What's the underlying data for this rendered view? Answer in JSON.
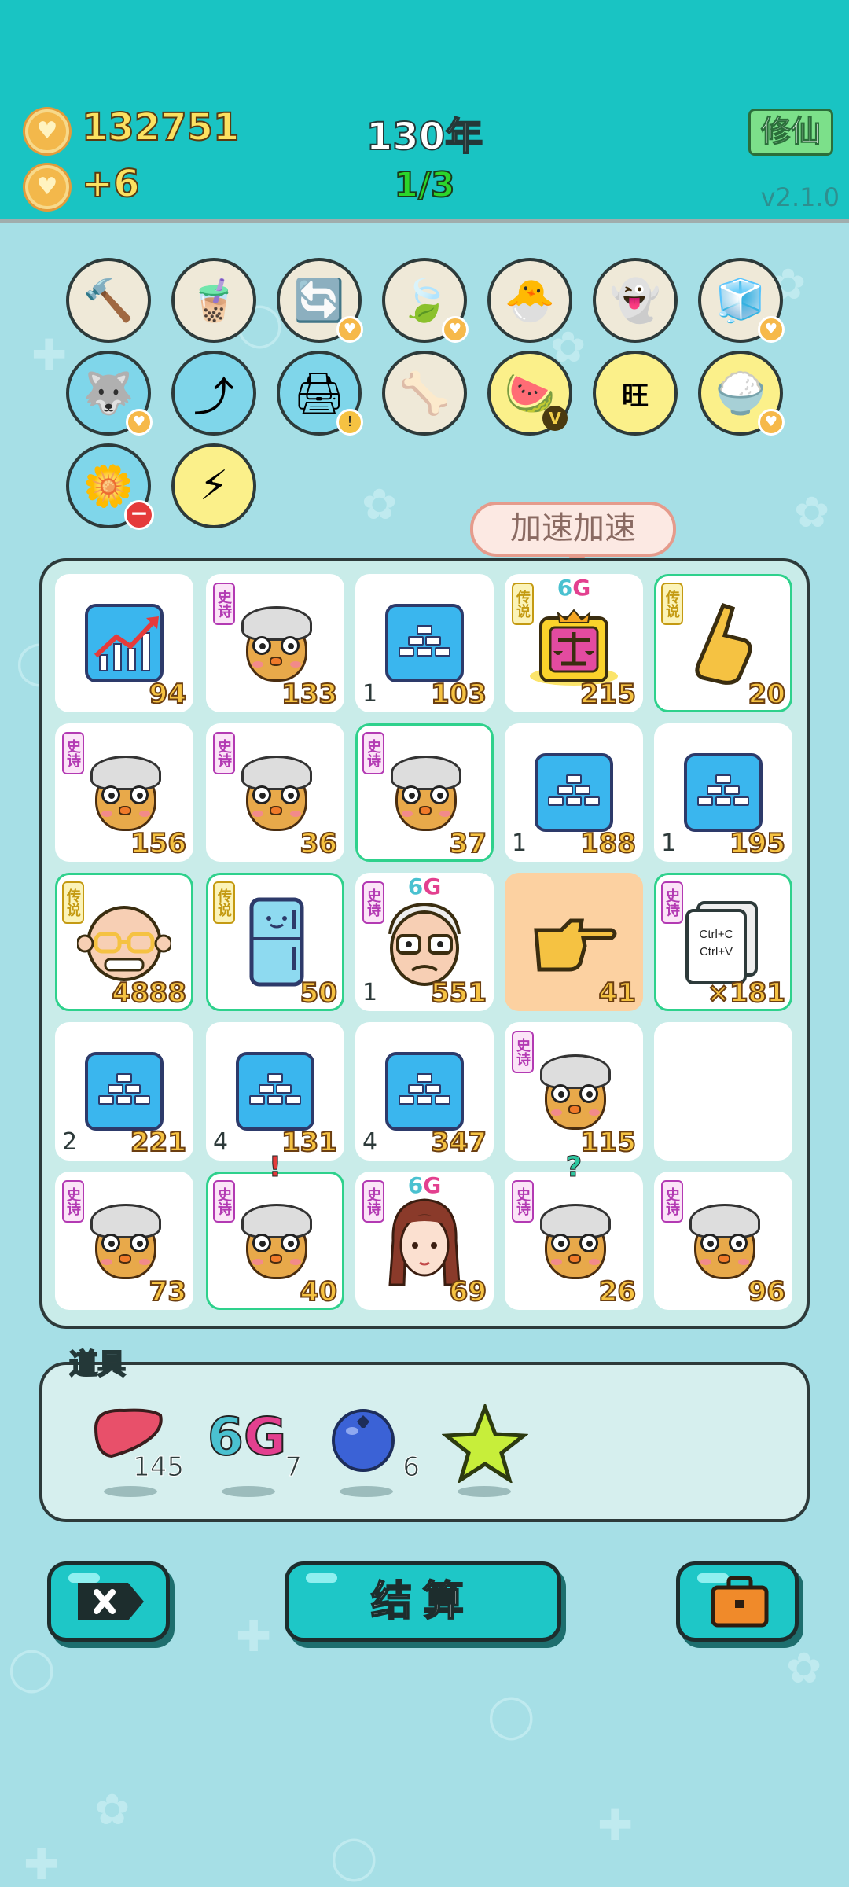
{
  "header": {
    "coins": "132751",
    "income": "+6",
    "year": "130年",
    "round": "1/3",
    "cultivate_button": "修仙",
    "version": "v2.1.0"
  },
  "skills": [
    {
      "icon": "hammer-icon",
      "glyph": "🔨"
    },
    {
      "icon": "milk-tea-icon",
      "glyph": "🧋"
    },
    {
      "icon": "refresh-icon",
      "glyph": "🔄",
      "heart": true
    },
    {
      "icon": "leaf-icon",
      "glyph": "🍃",
      "heart": true
    },
    {
      "icon": "chick-egg-icon",
      "glyph": "🐣"
    },
    {
      "icon": "ghost-icon",
      "glyph": "👻"
    },
    {
      "icon": "cubes-icon",
      "glyph": "🧊",
      "heart": true
    },
    {
      "icon": "husky-icon",
      "glyph": "🐺",
      "heart": true
    },
    {
      "icon": "arrow-card-icon",
      "glyph": "⤴"
    },
    {
      "icon": "printer-icon",
      "glyph": "🖨",
      "warn": true
    },
    {
      "icon": "dog-bowl-icon",
      "glyph": "🦴"
    },
    {
      "icon": "fruit-plate-icon",
      "glyph": "🍉",
      "v": "V"
    },
    {
      "icon": "wang-text-icon",
      "glyph": "旺"
    },
    {
      "icon": "rice-bowl-icon",
      "glyph": "🍚",
      "heart": true
    },
    {
      "icon": "flower-pot-icon",
      "glyph": "🌼",
      "minus": true
    },
    {
      "icon": "lightning-icon",
      "glyph": "⚡"
    }
  ],
  "tooltip": "加速加速",
  "badges": {
    "epic": "史诗",
    "legend": "传说"
  },
  "tag6g": {
    "six": "6",
    "g": "G"
  },
  "cells": [
    {
      "art": "chart",
      "num": "94"
    },
    {
      "art": "chick",
      "badge": "epic",
      "num": "133"
    },
    {
      "art": "gold",
      "lnum": "1",
      "num": "103"
    },
    {
      "art": "scale",
      "badge": "legend",
      "tag": "6G",
      "num": "215"
    },
    {
      "art": "pointer-up",
      "badge": "legend",
      "num": "20",
      "green": true
    },
    {
      "art": "chick",
      "badge": "epic",
      "num": "156"
    },
    {
      "art": "chick",
      "badge": "epic",
      "num": "36"
    },
    {
      "art": "chick",
      "badge": "epic",
      "num": "37",
      "green": true
    },
    {
      "art": "gold",
      "lnum": "1",
      "num": "188"
    },
    {
      "art": "gold",
      "lnum": "1",
      "num": "195"
    },
    {
      "art": "oldman",
      "badge": "legend",
      "num": "4888",
      "green": true
    },
    {
      "art": "fridge",
      "badge": "legend",
      "num": "50",
      "green": true
    },
    {
      "art": "grandpa",
      "badge": "epic",
      "tag": "6G",
      "lnum": "1",
      "num": "551"
    },
    {
      "art": "pointer-right",
      "num": "41",
      "orange": true
    },
    {
      "art": "copypaste",
      "badge": "epic",
      "num": "×181",
      "green": true
    },
    {
      "art": "gold",
      "lnum": "2",
      "num": "221"
    },
    {
      "art": "gold",
      "lnum": "4",
      "num": "131"
    },
    {
      "art": "gold",
      "lnum": "4",
      "num": "347"
    },
    {
      "art": "chick",
      "badge": "epic",
      "num": "115"
    },
    {
      "art": "empty",
      "num": ""
    },
    {
      "art": "chick",
      "badge": "epic",
      "num": "73"
    },
    {
      "art": "chick",
      "badge": "epic",
      "num": "40",
      "green": true,
      "mark": "!"
    },
    {
      "art": "girl",
      "badge": "epic",
      "tag": "6G",
      "num": "69"
    },
    {
      "art": "chick",
      "badge": "epic",
      "num": "26",
      "mark": "?"
    },
    {
      "art": "chick",
      "badge": "epic",
      "num": "96"
    }
  ],
  "copy_text": {
    "ctrl_c": "Ctrl+C",
    "ctrl_v": "Ctrl+V"
  },
  "items": {
    "title": "道具",
    "list": [
      {
        "icon": "liver-icon",
        "count": "145"
      },
      {
        "icon": "6g-icon",
        "count": "7"
      },
      {
        "icon": "blueberry-icon",
        "count": "6"
      },
      {
        "icon": "star-icon",
        "count": ""
      }
    ]
  },
  "buttons": {
    "settle": "结算"
  }
}
